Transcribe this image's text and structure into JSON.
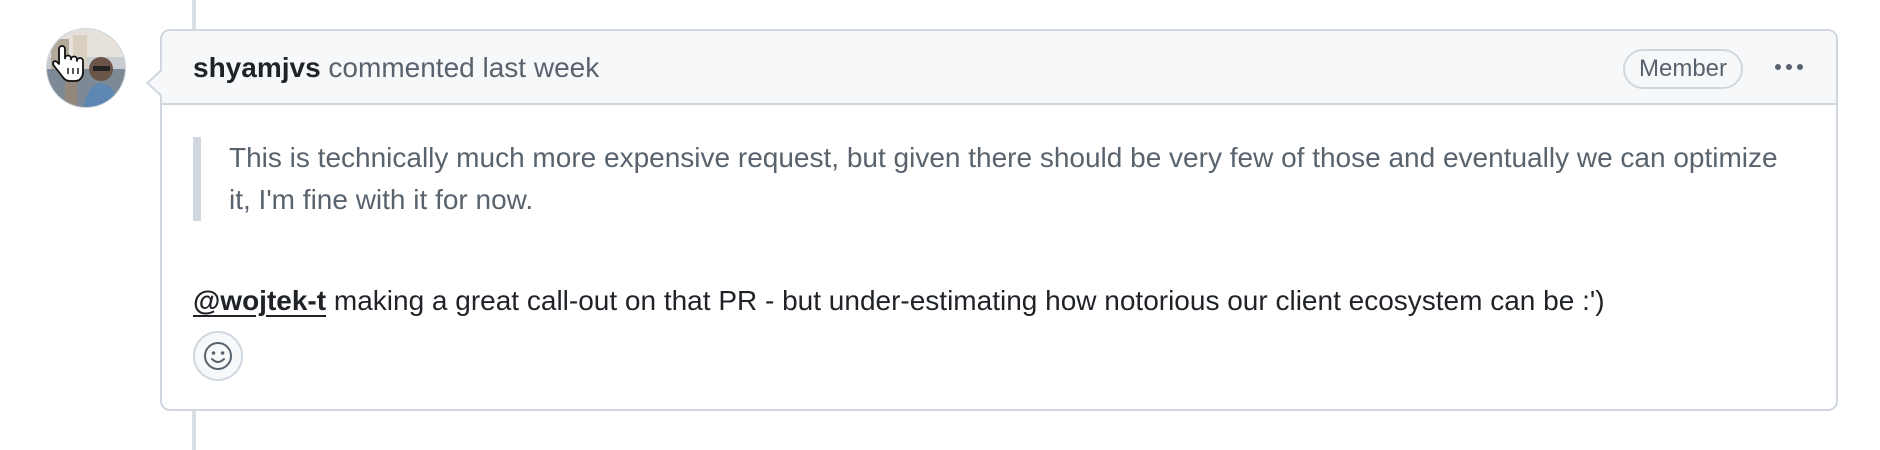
{
  "comment": {
    "author": "shyamjvs",
    "meta": "commented last week",
    "badge": "Member",
    "quote": "This is technically much more expensive request, but given there should be very few of those and eventually we can optimize it, I'm fine with it for now.",
    "mention": "@wojtek-t",
    "body_text": " making a great call-out on that PR - but under-estimating how notorious our client ecosystem can be :')"
  },
  "icons": {
    "avatar": "user-avatar",
    "cursor": "hand-pointer-icon",
    "more": "kebab-horizontal-icon",
    "reaction": "smiley-icon"
  },
  "colors": {
    "border": "#d0d7de",
    "header_bg": "#f6f8fa",
    "muted_text": "#59636e",
    "text": "#1f2328"
  }
}
